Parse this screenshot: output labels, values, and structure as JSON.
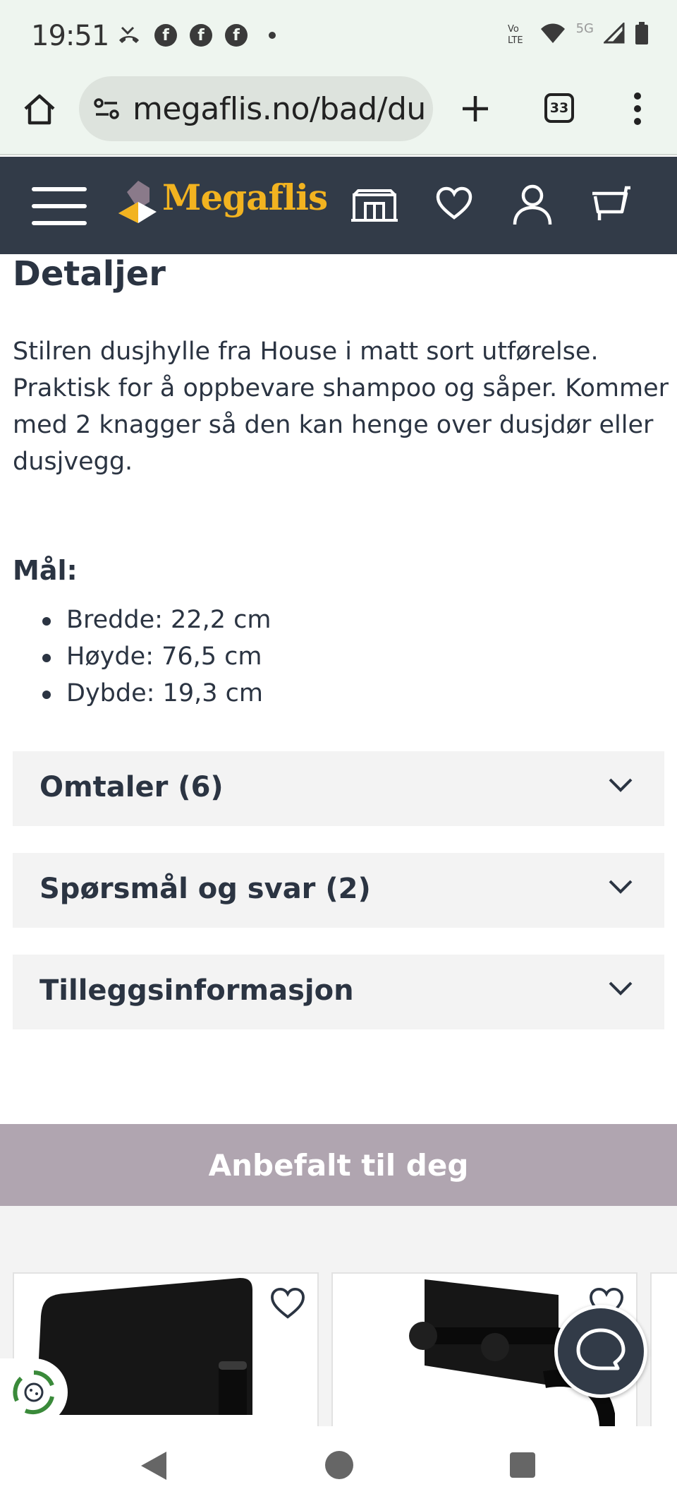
{
  "status_bar": {
    "time": "19:51",
    "network": "5G"
  },
  "browser": {
    "url": "megaflis.no/bad/du",
    "tab_count": "33"
  },
  "site_header": {
    "logo_text": "Megaflis",
    "brand_color": "#f2b320",
    "header_bg": "#323b48"
  },
  "details": {
    "title": "Detaljer",
    "description": "Stilren dusjhylle fra House i matt sort utførelse. Praktisk for å oppbevare shampoo og såper. Kommer med 2 knagger så den kan henge over dusjdør eller dusjvegg.",
    "dimensions_title": "Mål:",
    "dimensions": [
      "Bredde: 22,2 cm",
      "Høyde: 76,5 cm",
      "Dybde: 19,3 cm"
    ]
  },
  "accordions": [
    {
      "label": "Omtaler (6)"
    },
    {
      "label": "Spørsmål og svar (2)"
    },
    {
      "label": "Tilleggsinformasjon"
    }
  ],
  "recommendations": {
    "title": "Anbefalt til deg",
    "banner_color": "#b0a5b0"
  }
}
